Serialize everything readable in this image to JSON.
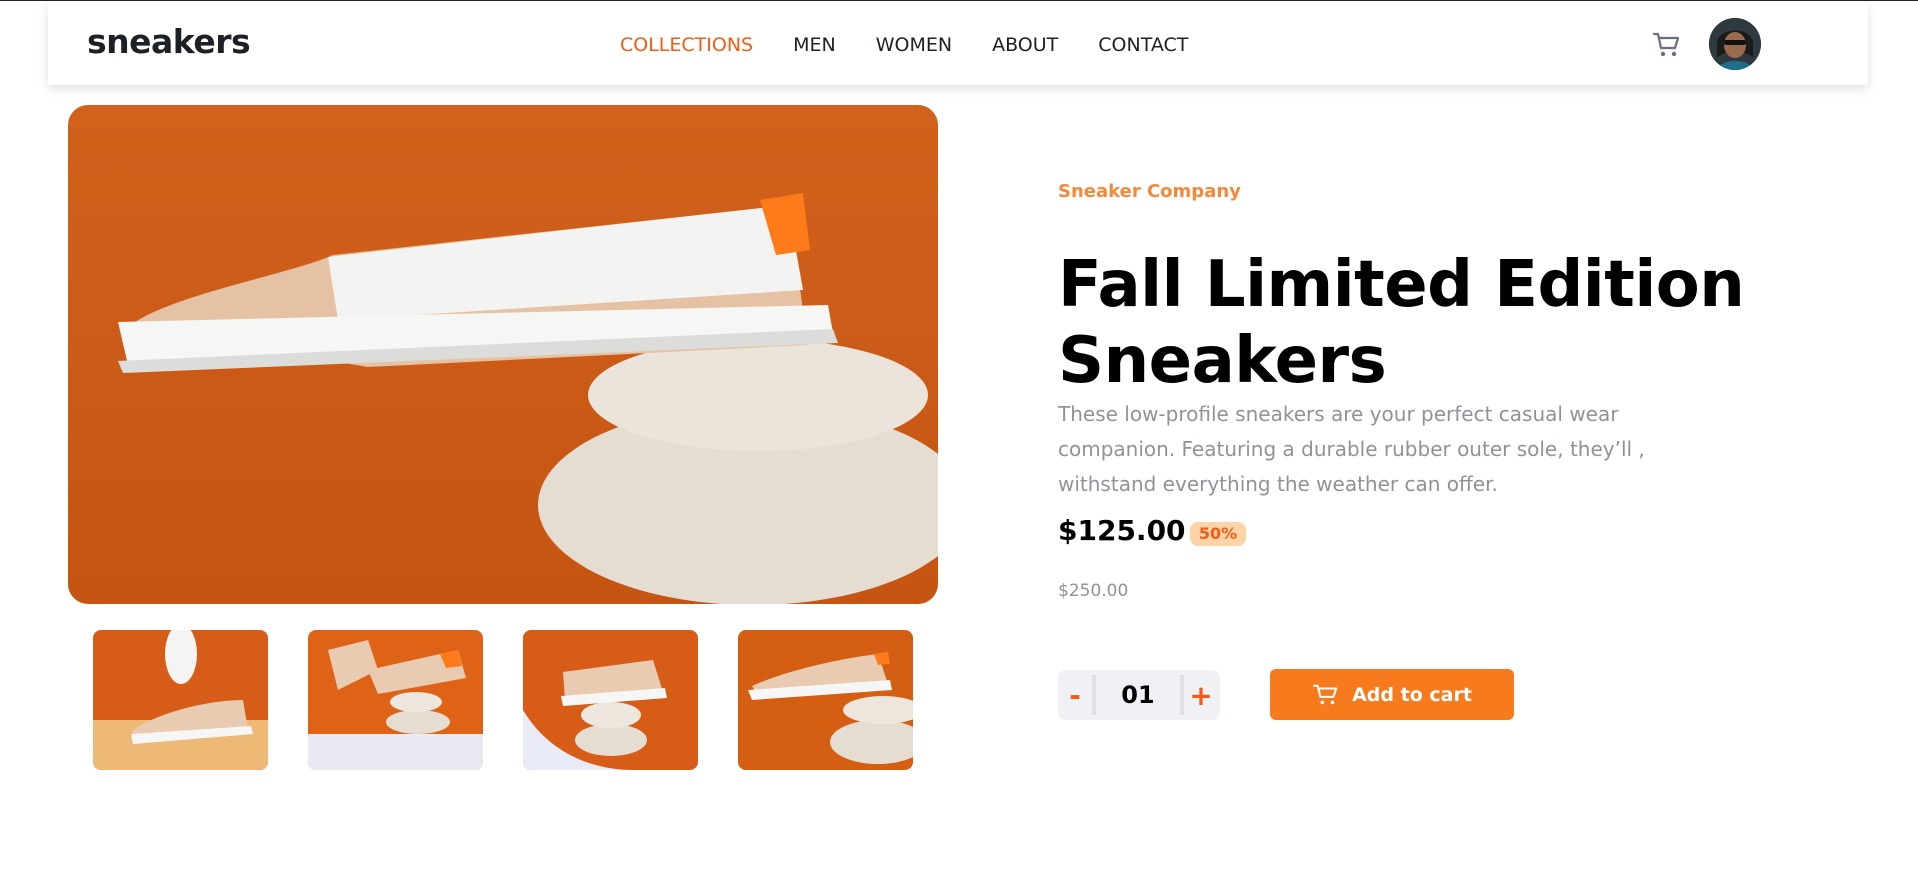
{
  "navbar": {
    "logo": "sneakers",
    "links": [
      {
        "label": "COLLECTIONS",
        "active": true
      },
      {
        "label": "MEN",
        "active": false
      },
      {
        "label": "WOMEN",
        "active": false
      },
      {
        "label": "ABOUT",
        "active": false
      },
      {
        "label": "CONTACT",
        "active": false
      }
    ],
    "cart_icon": "cart-icon",
    "avatar_icon": "avatar"
  },
  "product": {
    "company": "Sneaker Company",
    "title": "Fall Limited Edition Sneakers",
    "description": "These low-profile sneakers are your perfect casual wear companion. Featuring a durable rubber outer sole, they’ll , withstand everything the weather can offer.",
    "price": "$125.00",
    "discount": "50%",
    "original_price": "$250.00"
  },
  "cart_controls": {
    "minus": "-",
    "quantity": "01",
    "plus": "+",
    "add_label": "Add to cart"
  },
  "colors": {
    "accent": "#f77b1c",
    "active_nav": "#f15d16",
    "company": "#f5883b",
    "badge_bg": "#ffd3a8",
    "muted": "#8f9399",
    "product_bg": "#d45f12"
  }
}
